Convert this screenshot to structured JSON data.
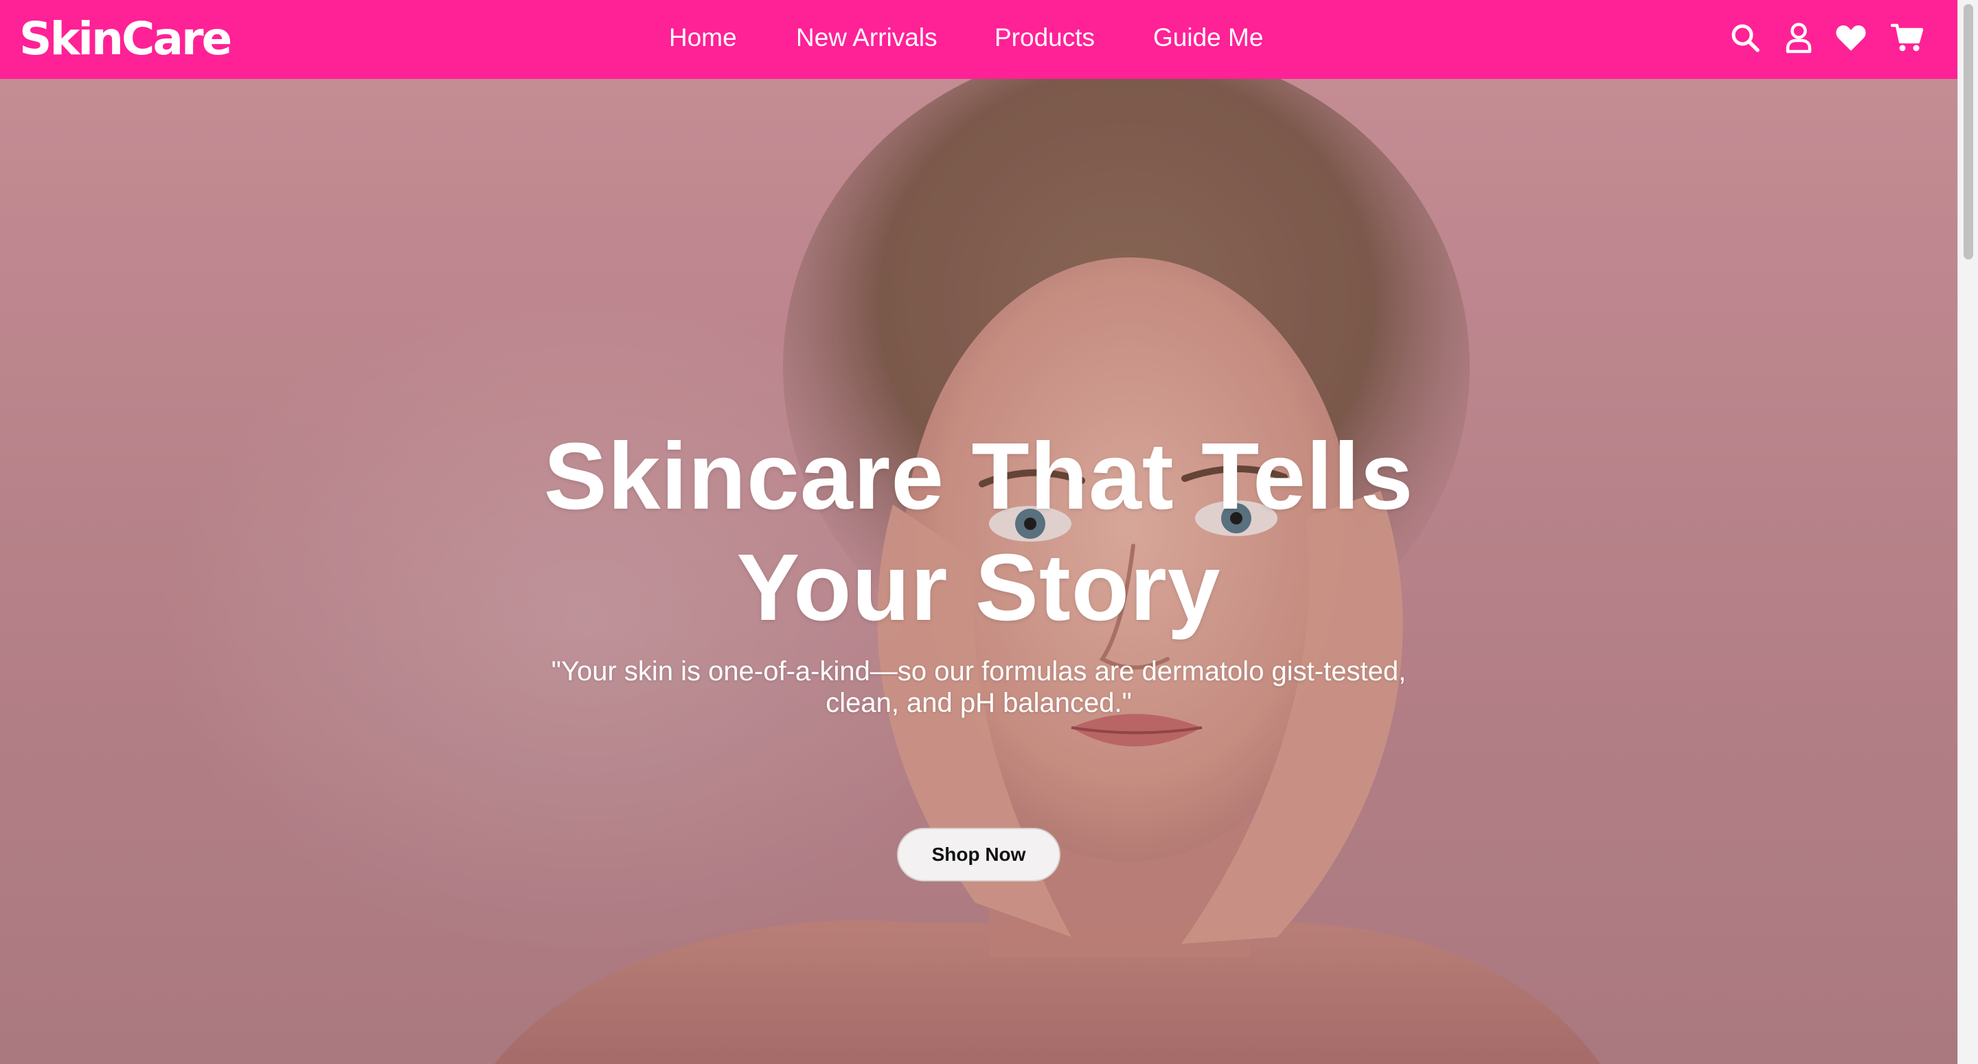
{
  "brand": {
    "name": "SkinCare"
  },
  "nav": {
    "links": [
      "Home",
      "New Arrivals",
      "Products",
      "Guide Me"
    ],
    "icons": [
      "search-icon",
      "user-icon",
      "heart-icon",
      "cart-icon"
    ]
  },
  "hero": {
    "title_line1": "Skincare That Tells",
    "title_line2": "Your Story",
    "subtitle_line1": "\"Your skin is one-of-a-kind—so our formulas are dermatolo gist-tested,",
    "subtitle_line2": "clean, and pH balanced.\"",
    "cta_label": "Shop Now"
  },
  "colors": {
    "nav_background": "#ff2196",
    "hero_background": "#c79097",
    "cta_background": "#f3f1f1"
  }
}
